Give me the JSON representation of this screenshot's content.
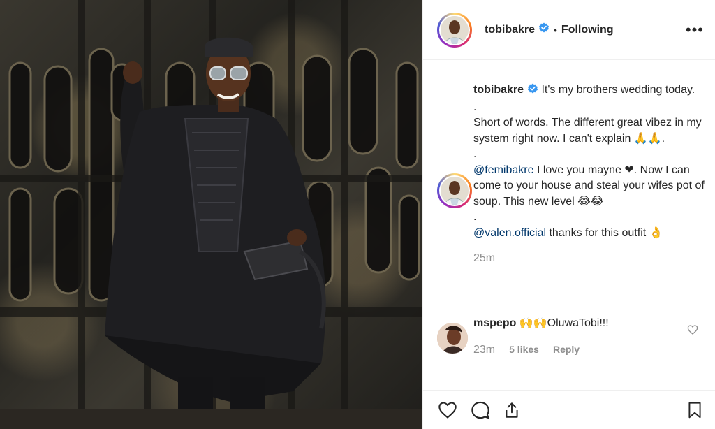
{
  "header": {
    "username": "tobibakre",
    "separator": "•",
    "follow_status": "Following",
    "more_label": "•••"
  },
  "caption": {
    "username": "tobibakre",
    "line1": "It's my brothers wedding today.",
    "dot1": ".",
    "line2": "Short of words. The different great vibez in my system right now. I can't explain 🙏🙏.",
    "dot2": ".",
    "mention1": "@femibakre",
    "line3": "I love you mayne ❤. Now I can come to your house and steal your wifes pot of soup. This new level 😂😂",
    "dot3": ".",
    "mention2": "@valen.official",
    "line4": "thanks for this outfit 👌",
    "time": "25m"
  },
  "comment": {
    "username": "mspepo",
    "text": "🙌🙌OluwaTobi!!!",
    "time": "23m",
    "likes": "5 likes",
    "reply": "Reply"
  },
  "icons": {
    "like": "heart-icon",
    "comment": "comment-icon",
    "share": "share-icon",
    "save": "bookmark-icon",
    "verified": "verified-badge-icon"
  },
  "colors": {
    "verified": "#3897f0",
    "mention": "#00376b",
    "secondary_text": "#8e8e8e"
  }
}
